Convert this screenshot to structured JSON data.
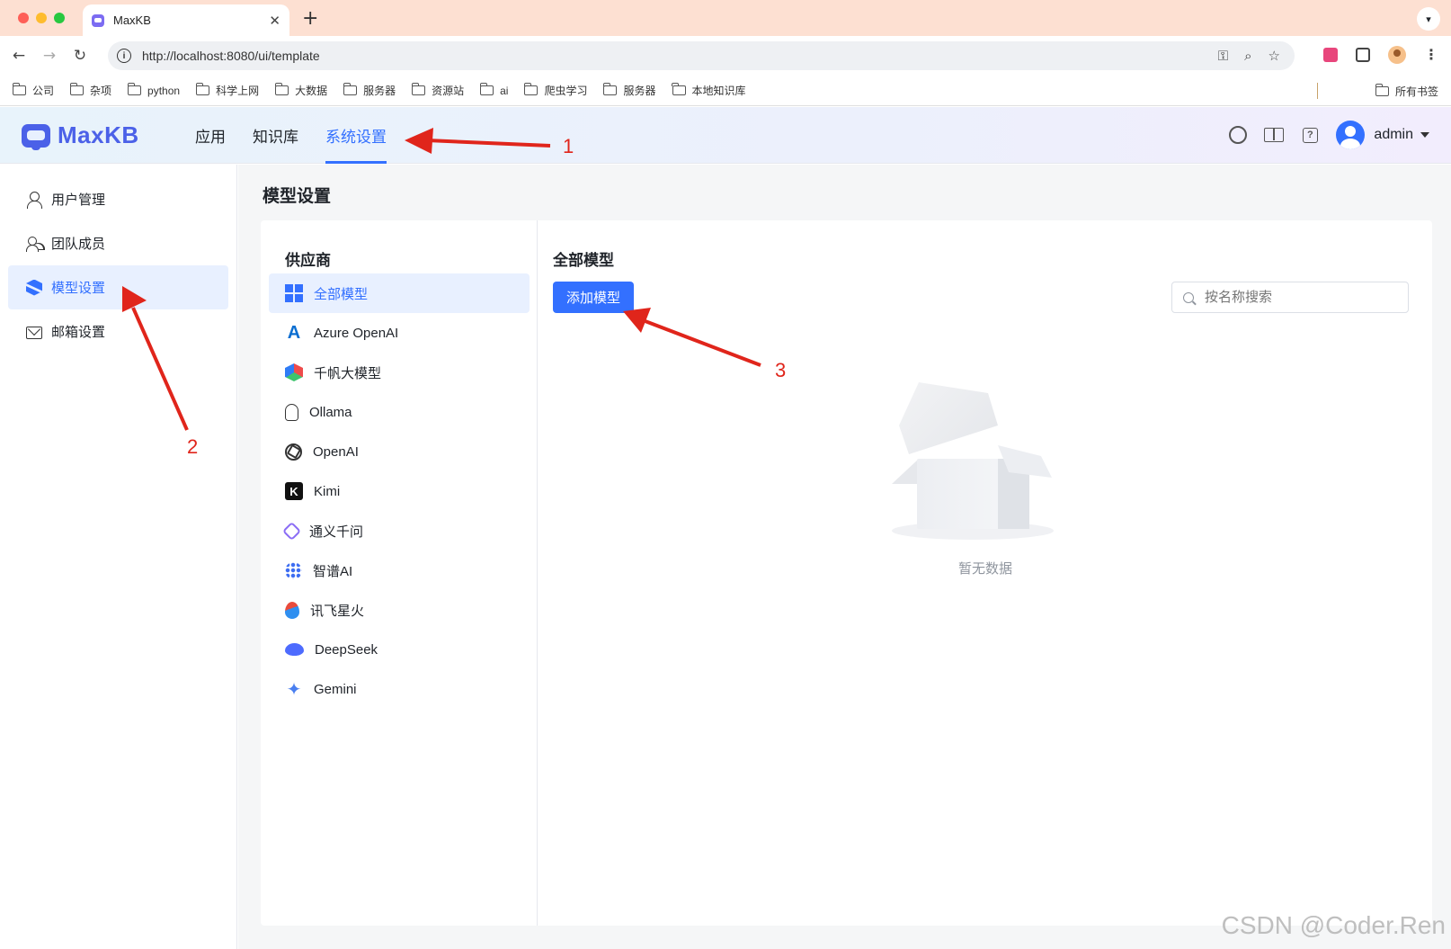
{
  "browser": {
    "tab_title": "MaxKB",
    "tab_close": "✕",
    "new_tab": "+",
    "url": "http://localhost:8080/ui/template",
    "bookmarks": [
      "公司",
      "杂项",
      "python",
      "科学上网",
      "大数据",
      "服务器",
      "资源站",
      "ai",
      "爬虫学习",
      "服务器",
      "本地知识库"
    ],
    "all_bookmarks": "所有书签"
  },
  "app": {
    "logo_text": "MaxKB",
    "nav": [
      "应用",
      "知识库",
      "系统设置"
    ],
    "user_name": "admin"
  },
  "sidebar": {
    "items": [
      "用户管理",
      "团队成员",
      "模型设置",
      "邮箱设置"
    ]
  },
  "main": {
    "page_title": "模型设置",
    "provider_title": "供应商",
    "providers": [
      "全部模型",
      "Azure OpenAI",
      "千帆大模型",
      "Ollama",
      "OpenAI",
      "Kimi",
      "通义千问",
      "智谱AI",
      "讯飞星火",
      "DeepSeek",
      "Gemini"
    ],
    "models_title": "全部模型",
    "add_button": "添加模型",
    "search_placeholder": "按名称搜索",
    "empty_text": "暂无数据"
  },
  "annotations": [
    "1",
    "2",
    "3"
  ],
  "watermark": "CSDN @Coder.Ren",
  "colors": {
    "primary": "#3370ff",
    "arrow": "#e0251b",
    "logo": "#4b61e8"
  }
}
